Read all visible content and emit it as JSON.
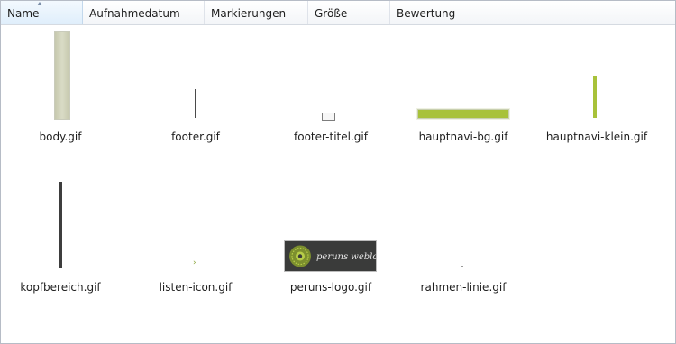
{
  "columns": [
    {
      "label": "Name",
      "sorted": true
    },
    {
      "label": "Aufnahmedatum"
    },
    {
      "label": "Markierungen"
    },
    {
      "label": "Größe"
    },
    {
      "label": "Bewertung"
    }
  ],
  "files": [
    {
      "name": "body.gif",
      "icon": "body-thumbnail"
    },
    {
      "name": "footer.gif",
      "icon": "footer-thumbnail"
    },
    {
      "name": "footer-titel.gif",
      "icon": "footer-titel-thumbnail"
    },
    {
      "name": "hauptnavi-bg.gif",
      "icon": "hauptnavi-bg-thumbnail"
    },
    {
      "name": "hauptnavi-klein.gif",
      "icon": "hauptnavi-klein-thumbnail"
    },
    {
      "name": "kopfbereich.gif",
      "icon": "kopfbereich-thumbnail"
    },
    {
      "name": "listen-icon.gif",
      "icon": "listen-icon-thumbnail"
    },
    {
      "name": "peruns-logo.gif",
      "icon": "peruns-logo-thumbnail",
      "logo_text": "peruns weblog"
    },
    {
      "name": "rahmen-linie.gif",
      "icon": "rahmen-linie-thumbnail"
    }
  ],
  "colors": {
    "green": "#a8c23a",
    "header_sorted": "#dfeefb"
  }
}
